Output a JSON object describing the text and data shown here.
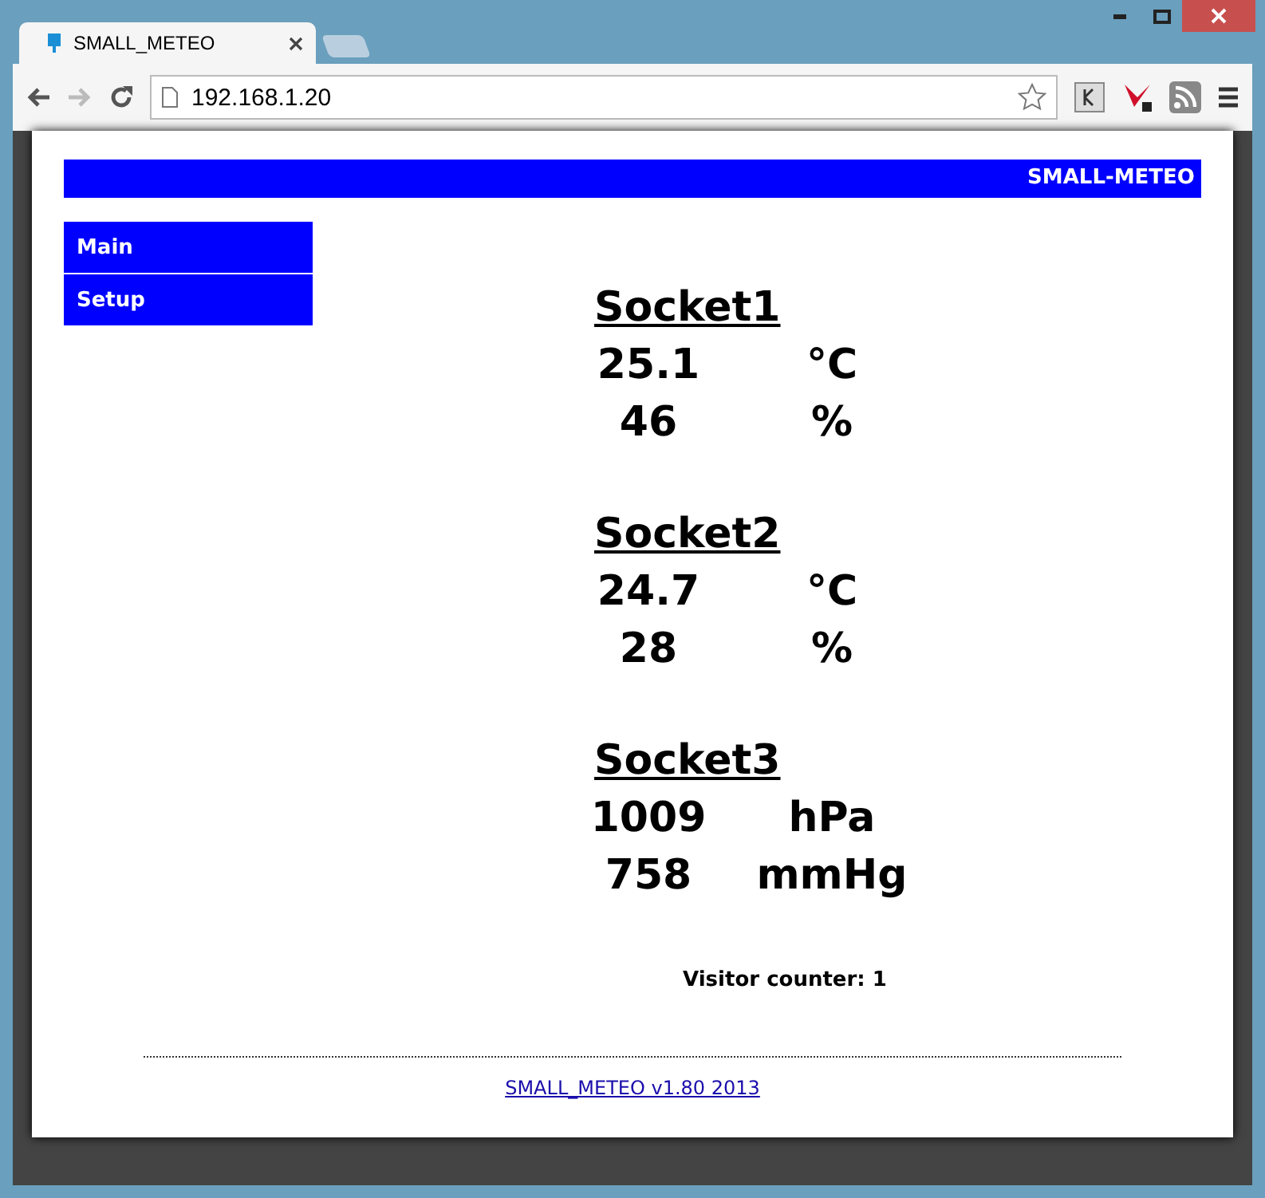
{
  "browser": {
    "tab_title": "SMALL_METEO",
    "url": "192.168.1.20"
  },
  "header": {
    "title": "SMALL-METEO"
  },
  "menu": [
    {
      "label": "Main"
    },
    {
      "label": "Setup"
    }
  ],
  "sockets": [
    {
      "name": "Socket1",
      "readings": [
        {
          "value": "25.1",
          "unit": "°C"
        },
        {
          "value": "46",
          "unit": "%"
        }
      ]
    },
    {
      "name": "Socket2",
      "readings": [
        {
          "value": "24.7",
          "unit": "°C"
        },
        {
          "value": "28",
          "unit": "%"
        }
      ]
    },
    {
      "name": "Socket3",
      "readings": [
        {
          "value": "1009",
          "unit": "hPa"
        },
        {
          "value": "758",
          "unit": "mmHg"
        }
      ]
    }
  ],
  "visitor_counter": "Visitor counter: 1",
  "footer_link": "SMALL_METEO v1.80 2013"
}
